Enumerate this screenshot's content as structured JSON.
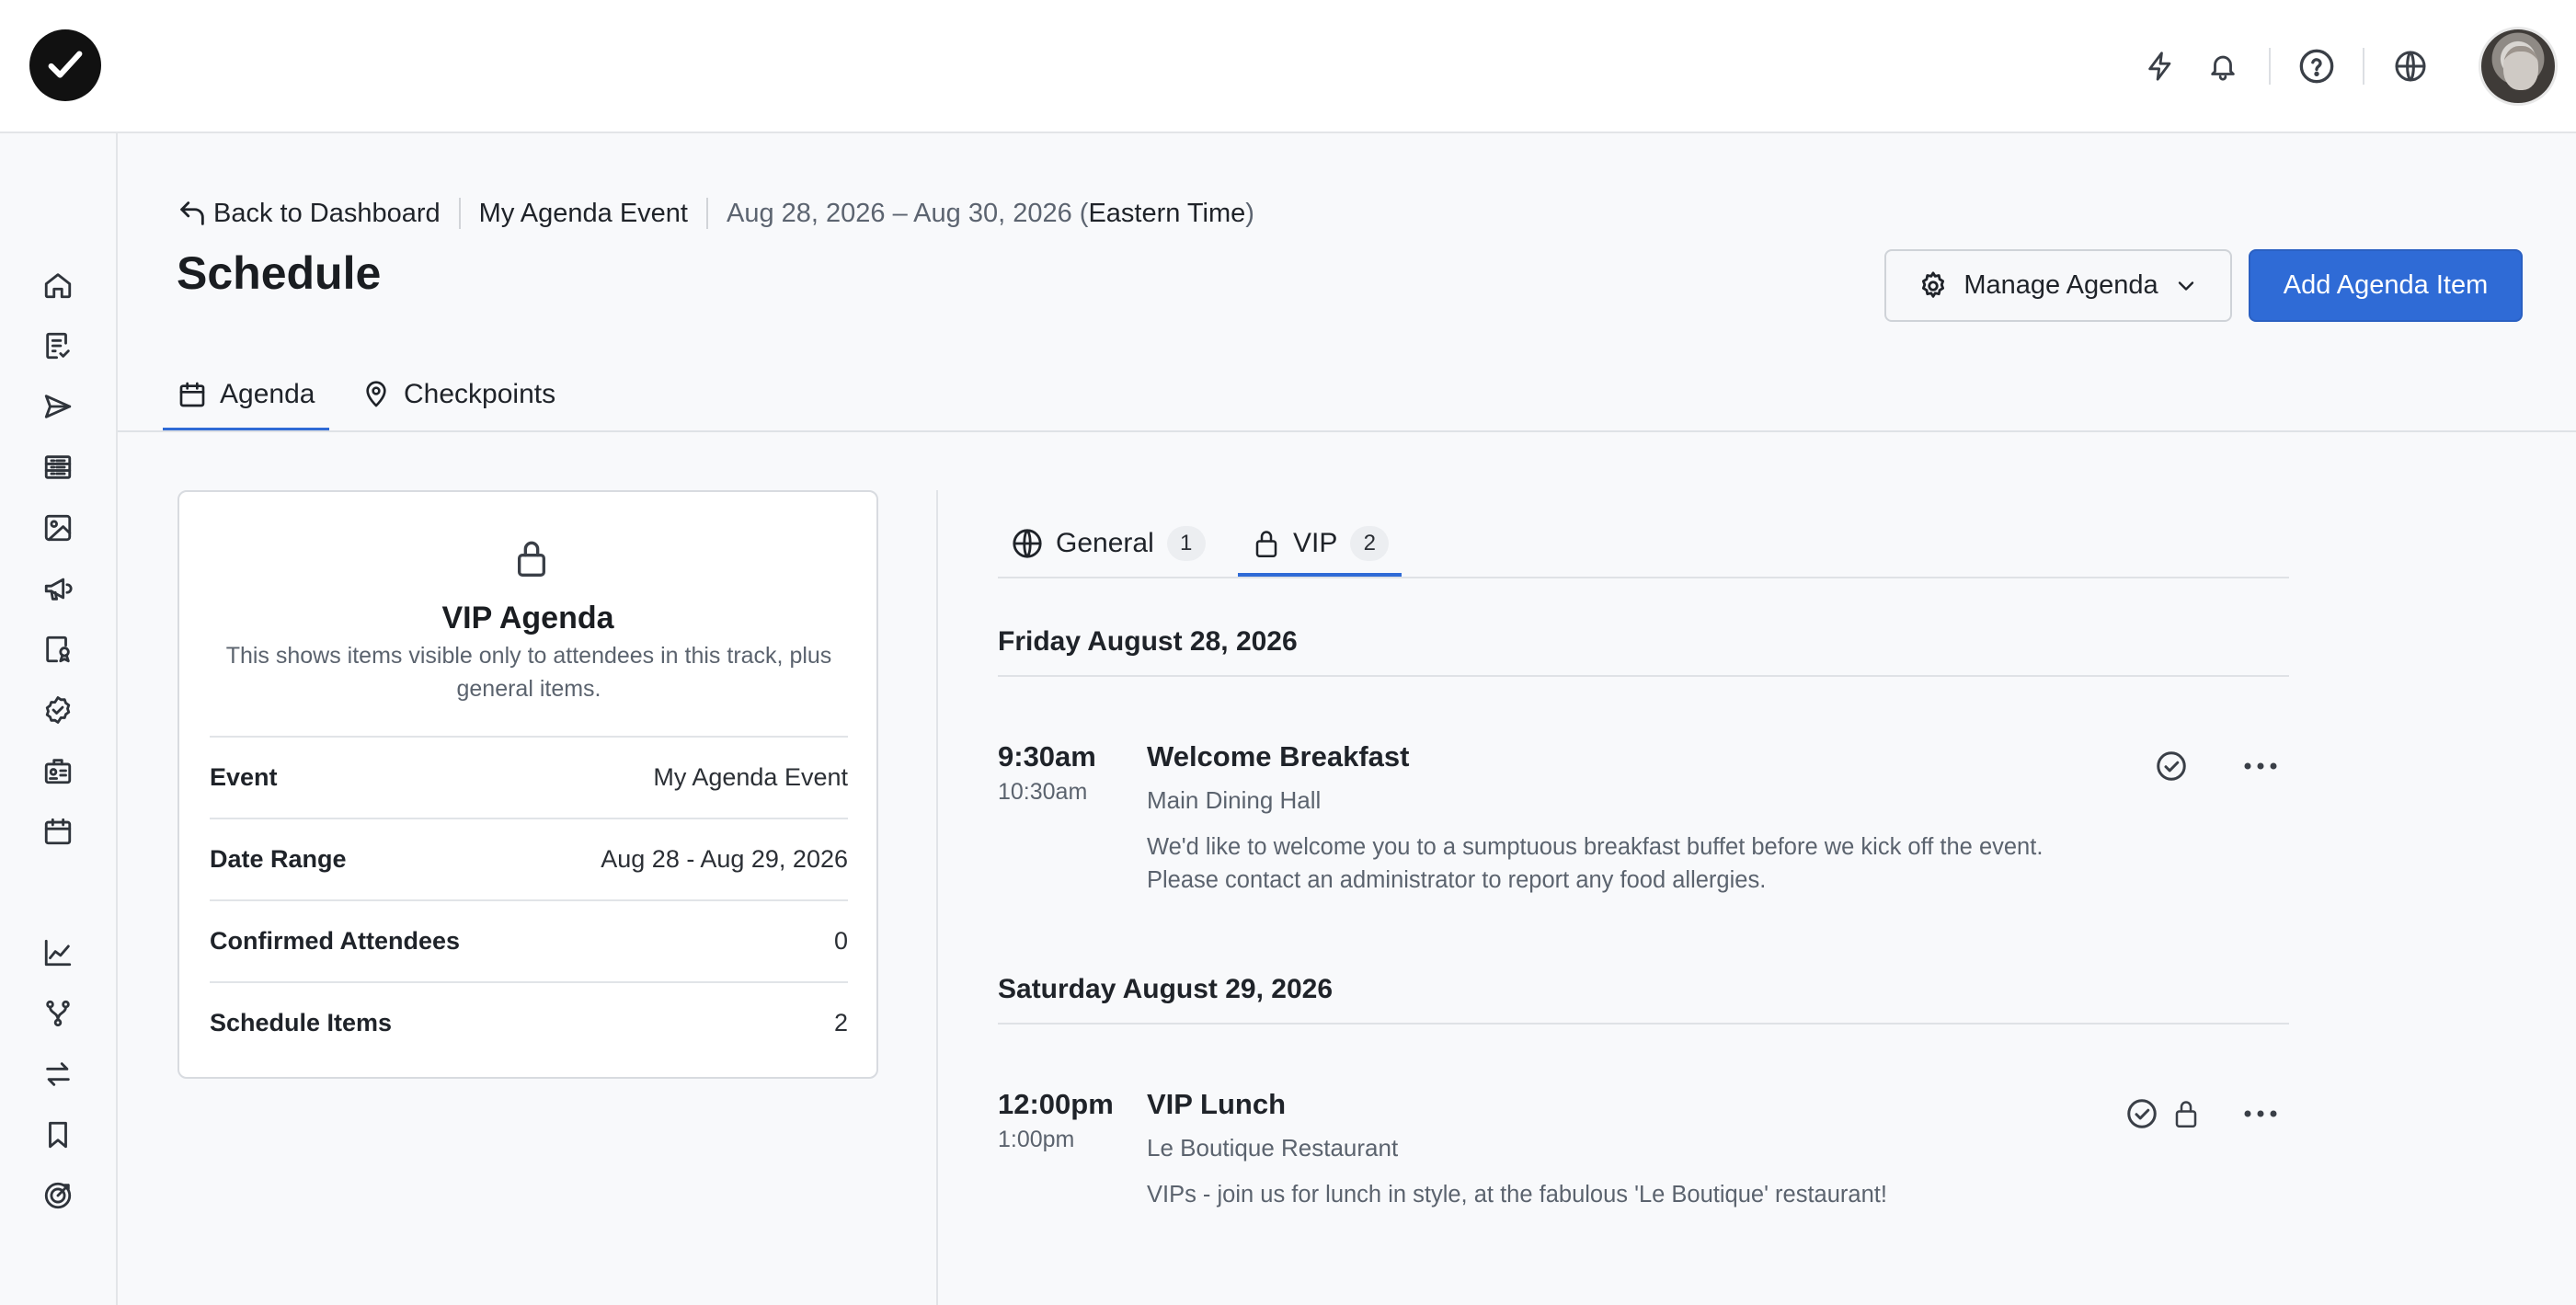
{
  "breadcrumb": {
    "back_label": "Back to Dashboard",
    "event_name": "My Agenda Event",
    "date_range": "Aug 28, 2026 – Aug 30, 2026 (",
    "timezone": "Eastern Time",
    "close_paren": ")"
  },
  "page": {
    "title": "Schedule"
  },
  "actions": {
    "manage_label": "Manage Agenda",
    "add_label": "Add Agenda Item"
  },
  "tabs": [
    {
      "label": "Agenda",
      "icon": "calendar-icon"
    },
    {
      "label": "Checkpoints",
      "icon": "map-pin-icon"
    }
  ],
  "card": {
    "title": "VIP Agenda",
    "description": "This shows items visible only to attendees in this track, plus general items.",
    "rows": [
      {
        "key": "Event",
        "value": "My Agenda Event"
      },
      {
        "key": "Date Range",
        "value": "Aug 28 - Aug 29, 2026"
      },
      {
        "key": "Confirmed Attendees",
        "value": "0"
      },
      {
        "key": "Schedule Items",
        "value": "2"
      }
    ]
  },
  "tracks": [
    {
      "label": "General",
      "count": "1",
      "icon": "globe-icon"
    },
    {
      "label": "VIP",
      "count": "2",
      "icon": "lock-icon"
    }
  ],
  "days": [
    {
      "heading": "Friday August 28, 2026",
      "items": [
        {
          "start": "9:30am",
          "end": "10:30am",
          "title": "Welcome Breakfast",
          "location": "Main Dining Hall",
          "description_line1": "We'd like to welcome you to a sumptuous breakfast buffet before we kick off the event.",
          "description_line2": "Please contact an administrator to report any food allergies."
        }
      ]
    },
    {
      "heading": "Saturday August 29, 2026",
      "items": [
        {
          "start": "12:00pm",
          "end": "1:00pm",
          "title": "VIP Lunch",
          "location": "Le Boutique Restaurant",
          "description_line1": "VIPs - join us for lunch in style, at the fabulous 'Le Boutique' restaurant!"
        }
      ]
    }
  ],
  "colors": {
    "accent": "#2f6bd6",
    "text": "#1f2329",
    "muted": "#5b636e"
  }
}
